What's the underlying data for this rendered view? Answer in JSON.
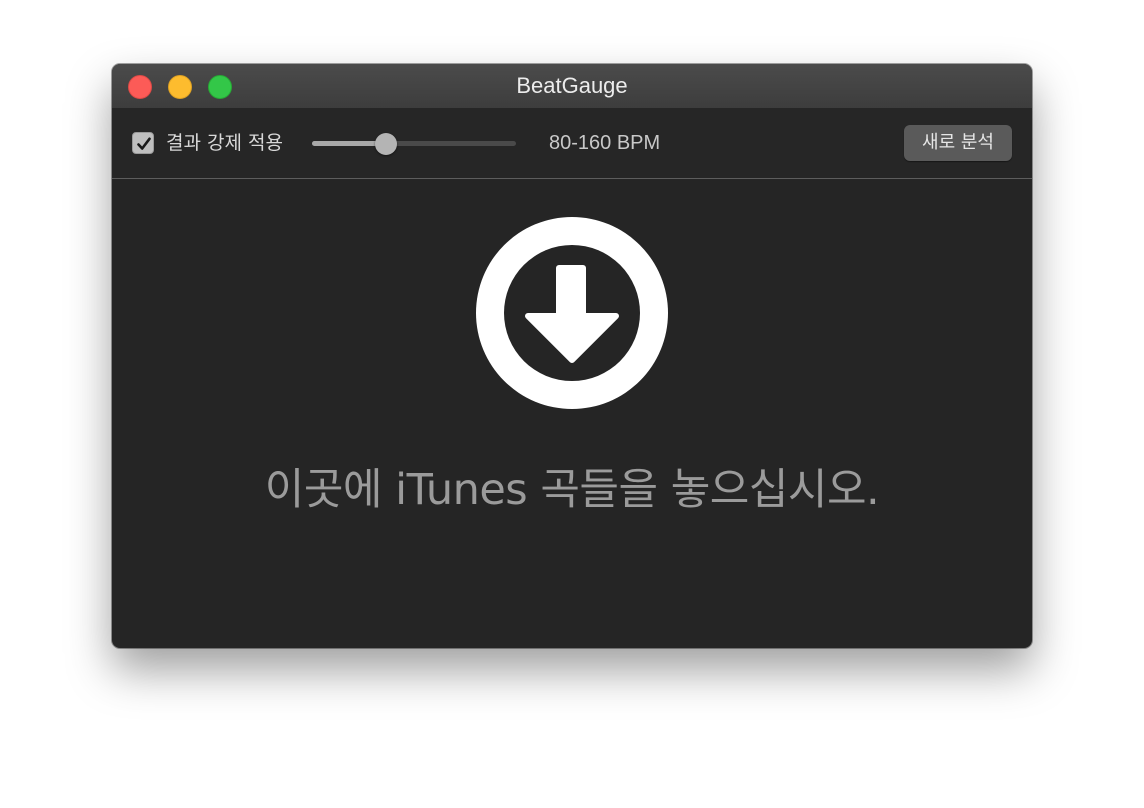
{
  "window": {
    "title": "BeatGauge"
  },
  "toolbar": {
    "checkbox_label": "결과 강제 적용",
    "checkbox_checked": true,
    "tempo_range": "80-160 BPM",
    "analyze_button": "새로 분석"
  },
  "main": {
    "drop_icon": "download-arrow-circle-icon",
    "drop_prompt": "이곳에 iTunes 곡들을 놓으십시오."
  },
  "colors": {
    "background": "#252525",
    "close": "#fc5b57",
    "minimize": "#fdbc2e",
    "zoom": "#33c748"
  }
}
